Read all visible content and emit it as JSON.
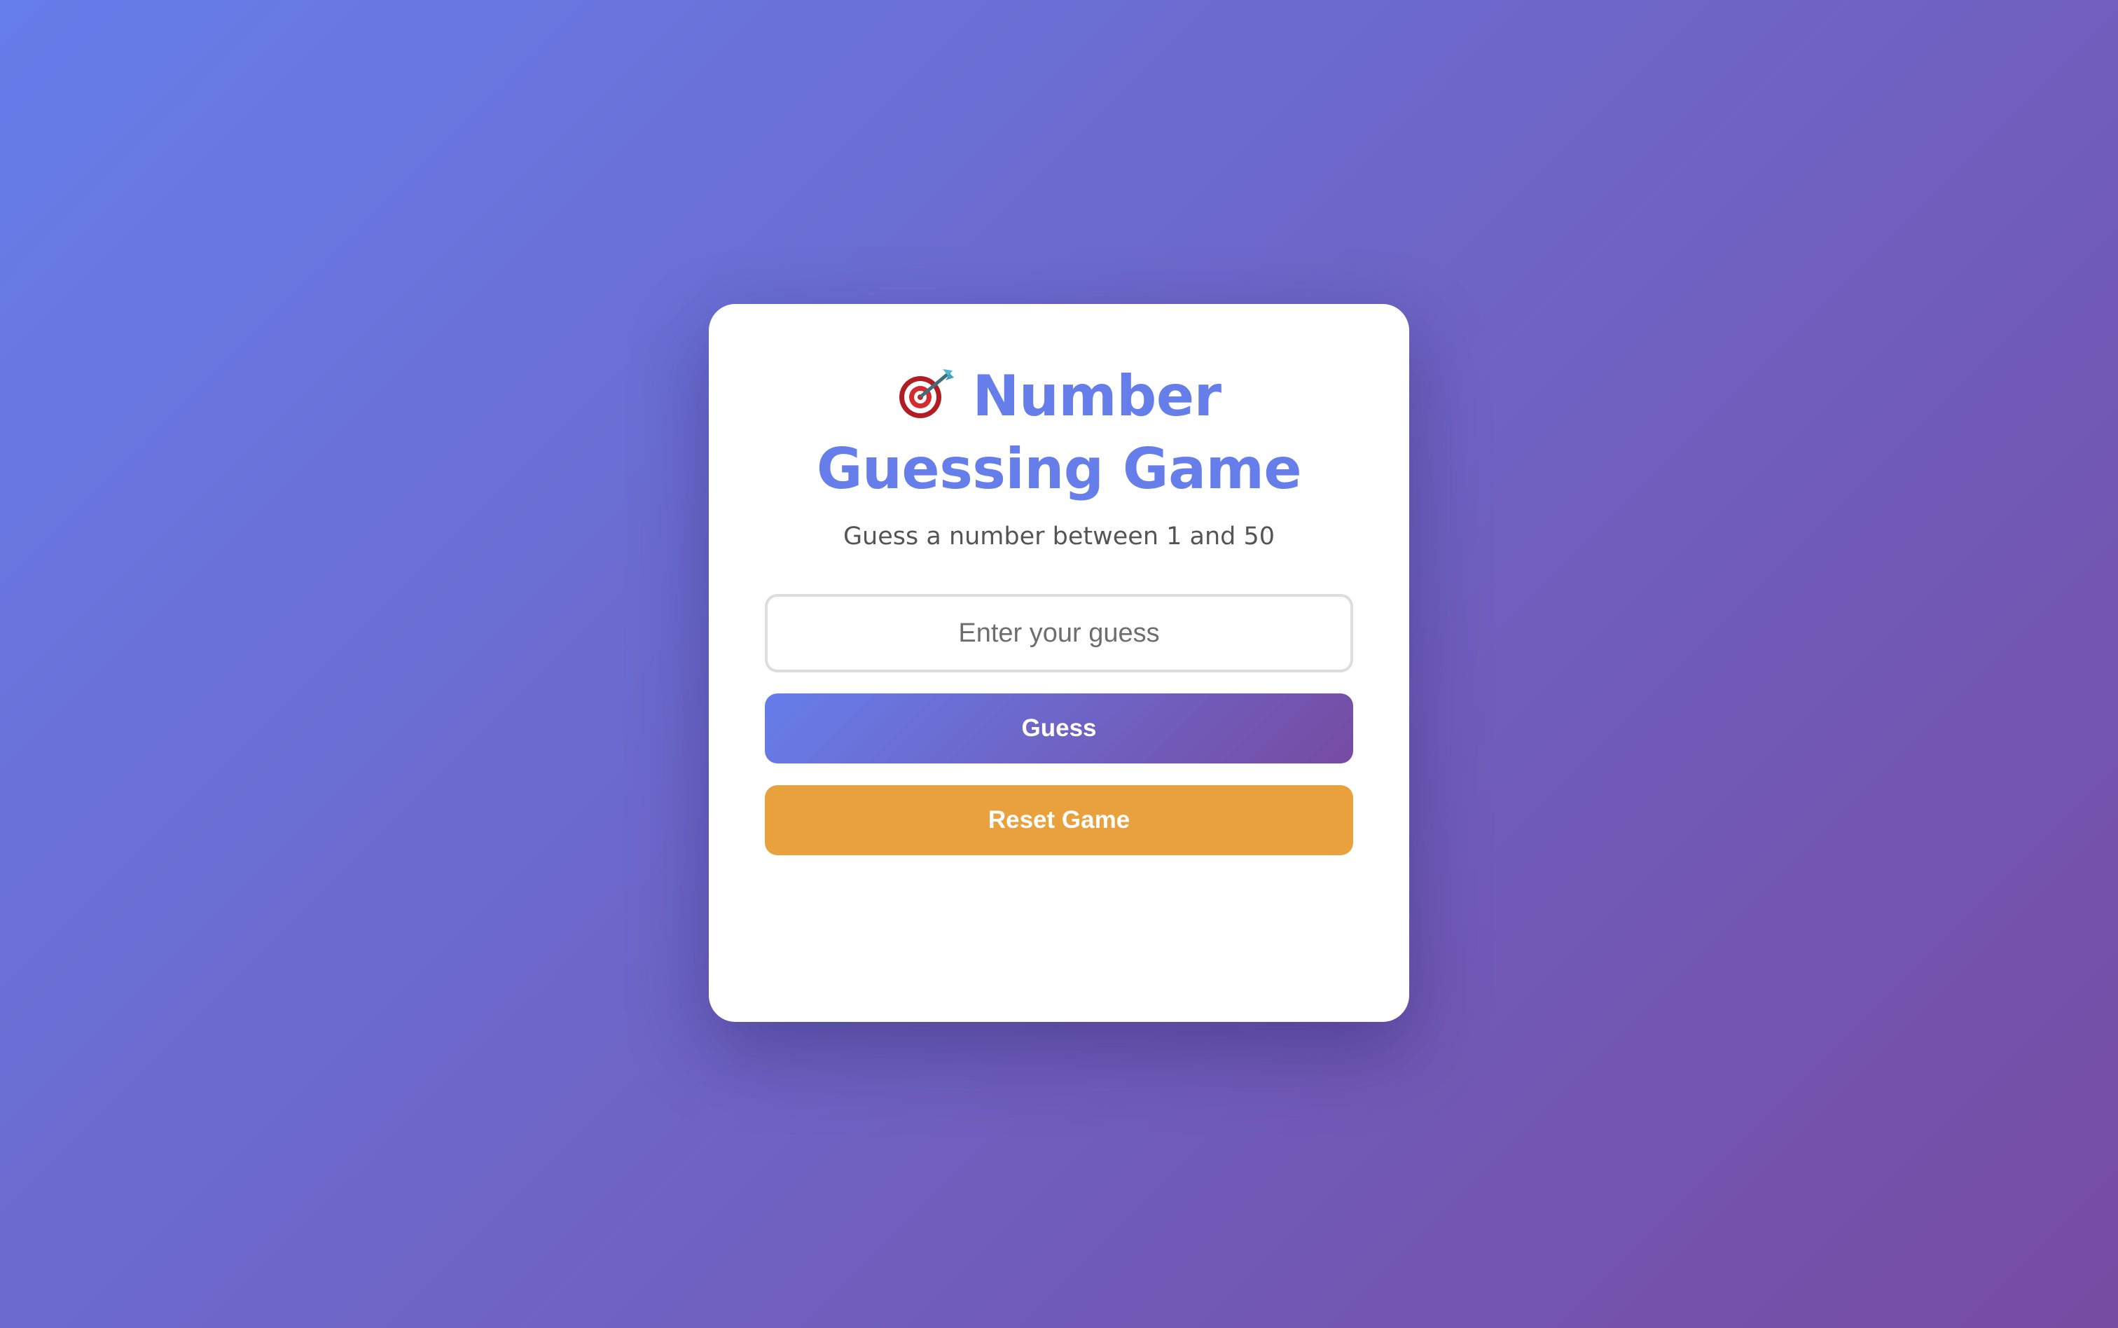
{
  "app": {
    "title": "Number Guessing Game",
    "title_icon": "direct-hit-target-icon",
    "subtitle": "Guess a number between 1 and 50"
  },
  "input": {
    "value": "",
    "placeholder": "Enter your guess"
  },
  "buttons": {
    "guess_label": "Guess",
    "reset_label": "Reset Game"
  },
  "colors": {
    "background_start": "#667eea",
    "background_end": "#764ba2",
    "title": "#667eea",
    "reset_button": "#e8a13c"
  }
}
